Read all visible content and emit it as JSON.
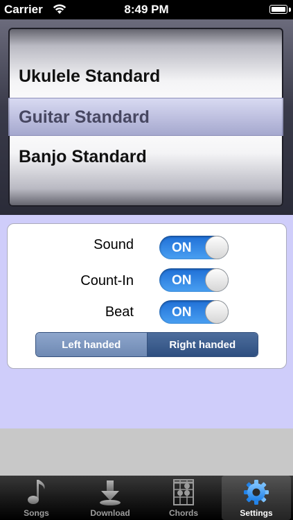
{
  "status_bar": {
    "carrier": "Carrier",
    "time": "8:49 PM"
  },
  "tuning_picker": {
    "rows": [
      "Ukulele Standard",
      "Guitar Standard",
      "Banjo Standard"
    ],
    "selected": "Guitar Standard"
  },
  "settings": {
    "sound": {
      "label": "Sound",
      "state": "ON"
    },
    "count_in": {
      "label": "Count-In",
      "state": "ON"
    },
    "beat": {
      "label": "Beat",
      "state": "ON"
    },
    "handedness": {
      "options": [
        "Left handed",
        "Right handed"
      ],
      "selected": "Right handed"
    }
  },
  "tab_bar": {
    "tabs": [
      {
        "label": "Songs",
        "icon": "music-note-icon"
      },
      {
        "label": "Download",
        "icon": "download-icon"
      },
      {
        "label": "Chords",
        "icon": "chord-grid-icon"
      },
      {
        "label": "Settings",
        "icon": "gear-icon"
      }
    ],
    "selected": "Settings"
  },
  "colors": {
    "accent": "#2f7fe6",
    "background": "#cfcdfa",
    "segment_selected": "#2e4f80"
  }
}
